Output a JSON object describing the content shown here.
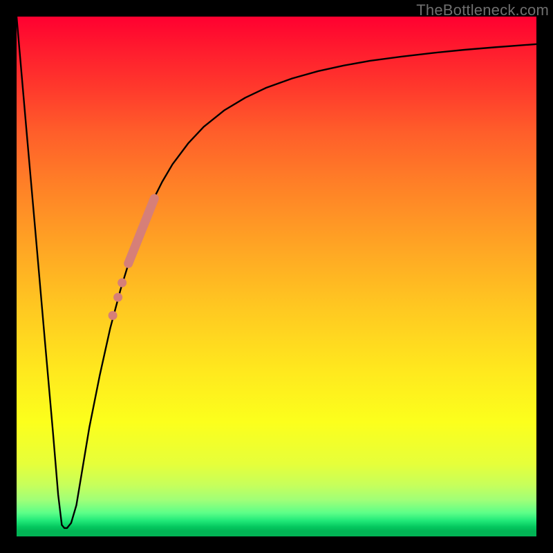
{
  "watermark": "TheBottleneck.com",
  "colors": {
    "frame": "#000000",
    "curve": "#000000",
    "dots": "#d67f78"
  },
  "chart_data": {
    "type": "line",
    "title": "",
    "xlabel": "",
    "ylabel": "",
    "xlim": [
      0,
      100
    ],
    "ylim": [
      0,
      100
    ],
    "grid": false,
    "series": [
      {
        "name": "bottleneck-curve",
        "x": [
          0.0,
          2.0,
          3.5,
          5.5,
          7.0,
          8.0,
          8.7,
          9.2,
          9.7,
          10.5,
          11.5,
          12.5,
          14.0,
          16.0,
          18.0,
          20.0,
          22.0,
          24.0,
          26.0,
          28.0,
          30.0,
          33.0,
          36.0,
          40.0,
          44.0,
          48.0,
          53.0,
          58.0,
          63.0,
          68.0,
          74.0,
          80.0,
          86.0,
          92.0,
          100.0
        ],
        "y": [
          100.0,
          77.0,
          60.0,
          37.0,
          20.0,
          8.0,
          2.2,
          1.6,
          1.6,
          2.6,
          6.0,
          12.0,
          21.0,
          31.0,
          40.0,
          47.5,
          54.0,
          59.5,
          64.2,
          68.2,
          71.6,
          75.6,
          78.8,
          82.0,
          84.4,
          86.3,
          88.1,
          89.5,
          90.6,
          91.5,
          92.3,
          93.0,
          93.6,
          94.1,
          94.7
        ]
      }
    ],
    "markers": {
      "name": "highlighted-segment",
      "color": "#d67f78",
      "thick_segment": {
        "x": [
          21.5,
          26.5
        ],
        "y": [
          52.5,
          65.0
        ]
      },
      "points": [
        {
          "x": 19.5,
          "y": 46.0
        },
        {
          "x": 20.3,
          "y": 48.8
        },
        {
          "x": 18.5,
          "y": 42.5
        }
      ]
    }
  }
}
